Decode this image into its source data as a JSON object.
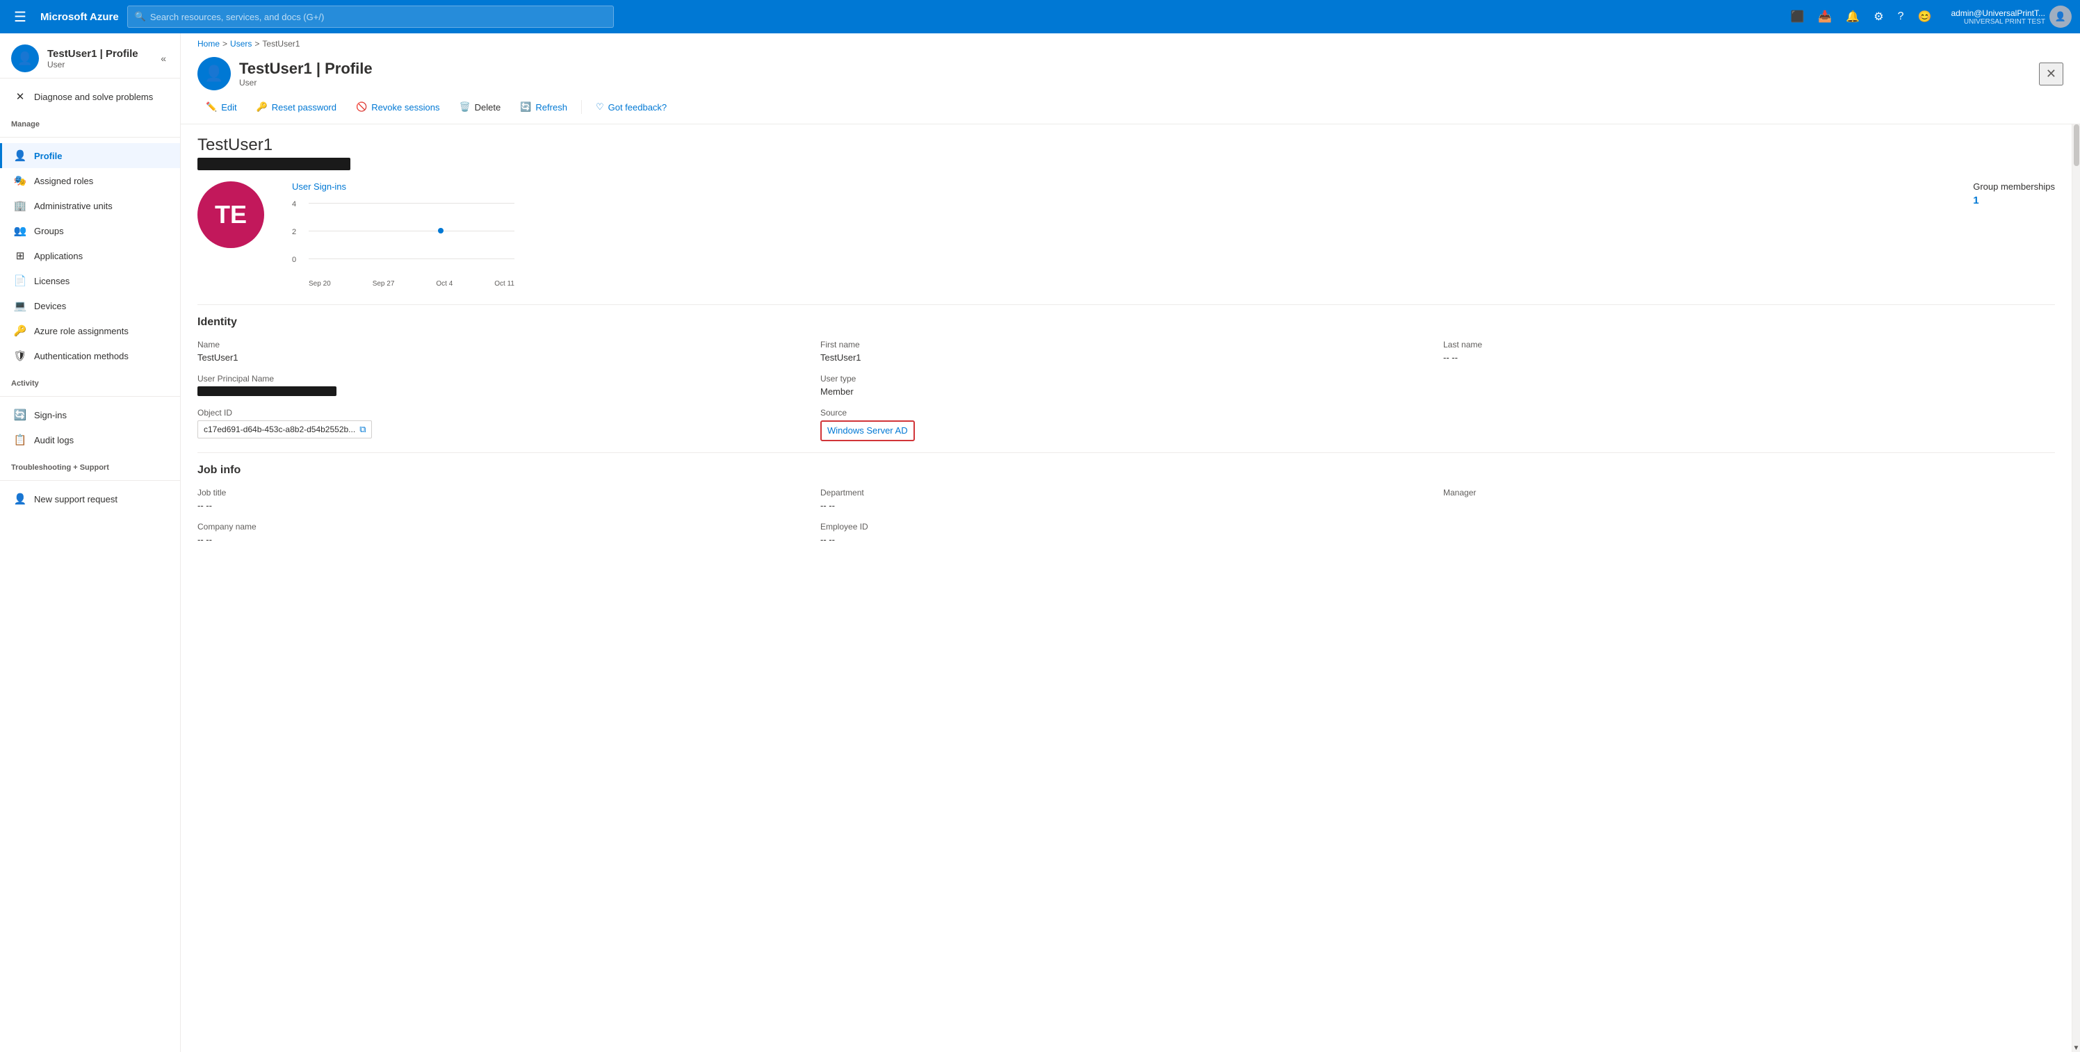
{
  "topnav": {
    "hamburger": "☰",
    "brand": "Microsoft Azure",
    "search_placeholder": "Search resources, services, and docs (G+/)",
    "user_name": "admin@UniversalPrintT...",
    "user_tenant": "UNIVERSAL PRINT TEST",
    "icons": [
      "📋",
      "📥",
      "🔔",
      "⚙",
      "?",
      "😊"
    ]
  },
  "breadcrumb": {
    "home": "Home",
    "users": "Users",
    "current": "TestUser1"
  },
  "page_header": {
    "title": "TestUser1 | Profile",
    "subtitle": "User",
    "avatar_initials": "TE"
  },
  "toolbar": {
    "edit_label": "Edit",
    "reset_password_label": "Reset password",
    "revoke_sessions_label": "Revoke sessions",
    "delete_label": "Delete",
    "refresh_label": "Refresh",
    "feedback_label": "Got feedback?"
  },
  "main": {
    "user_title": "TestUser1",
    "avatar_initials": "TE"
  },
  "chart": {
    "title": "User Sign-ins",
    "y_labels": [
      "4",
      "2",
      "0"
    ],
    "x_labels": [
      "Sep 20",
      "Sep 27",
      "Oct 4",
      "Oct 11"
    ]
  },
  "group_memberships": {
    "label": "Group memberships",
    "value": "1"
  },
  "identity": {
    "section_title": "Identity",
    "name_label": "Name",
    "name_value": "TestUser1",
    "first_name_label": "First name",
    "first_name_value": "TestUser1",
    "last_name_label": "Last name",
    "last_name_value": "-- --",
    "upn_label": "User Principal Name",
    "upn_value": "[REDACTED]",
    "user_type_label": "User type",
    "user_type_value": "Member",
    "object_id_label": "Object ID",
    "object_id_value": "c17ed691-d64b-453c-a8b2-d54b2552b...",
    "source_label": "Source",
    "source_value": "Windows Server AD"
  },
  "job_info": {
    "section_title": "Job info",
    "job_title_label": "Job title",
    "job_title_value": "-- --",
    "department_label": "Department",
    "department_value": "-- --",
    "manager_label": "Manager",
    "manager_value": "",
    "company_name_label": "Company name",
    "company_name_value": "-- --",
    "employee_id_label": "Employee ID",
    "employee_id_value": "-- --"
  },
  "sidebar": {
    "diagnose_label": "Diagnose and solve problems",
    "manage_label": "Manage",
    "items_manage": [
      {
        "label": "Profile",
        "icon": "👤",
        "id": "profile",
        "active": true
      },
      {
        "label": "Assigned roles",
        "icon": "🎭",
        "id": "assigned-roles",
        "active": false
      },
      {
        "label": "Administrative units",
        "icon": "🏢",
        "id": "admin-units",
        "active": false
      },
      {
        "label": "Groups",
        "icon": "👥",
        "id": "groups",
        "active": false
      },
      {
        "label": "Applications",
        "icon": "⊞",
        "id": "applications",
        "active": false
      },
      {
        "label": "Licenses",
        "icon": "📄",
        "id": "licenses",
        "active": false
      },
      {
        "label": "Devices",
        "icon": "💻",
        "id": "devices",
        "active": false
      },
      {
        "label": "Azure role assignments",
        "icon": "🔑",
        "id": "azure-roles",
        "active": false
      },
      {
        "label": "Authentication methods",
        "icon": "🛡",
        "id": "auth-methods",
        "active": false
      }
    ],
    "activity_label": "Activity",
    "items_activity": [
      {
        "label": "Sign-ins",
        "icon": "🔄",
        "id": "sign-ins",
        "active": false
      },
      {
        "label": "Audit logs",
        "icon": "📋",
        "id": "audit-logs",
        "active": false
      }
    ],
    "troubleshooting_label": "Troubleshooting + Support",
    "items_troubleshooting": [
      {
        "label": "New support request",
        "icon": "👤",
        "id": "support",
        "active": false
      }
    ]
  }
}
